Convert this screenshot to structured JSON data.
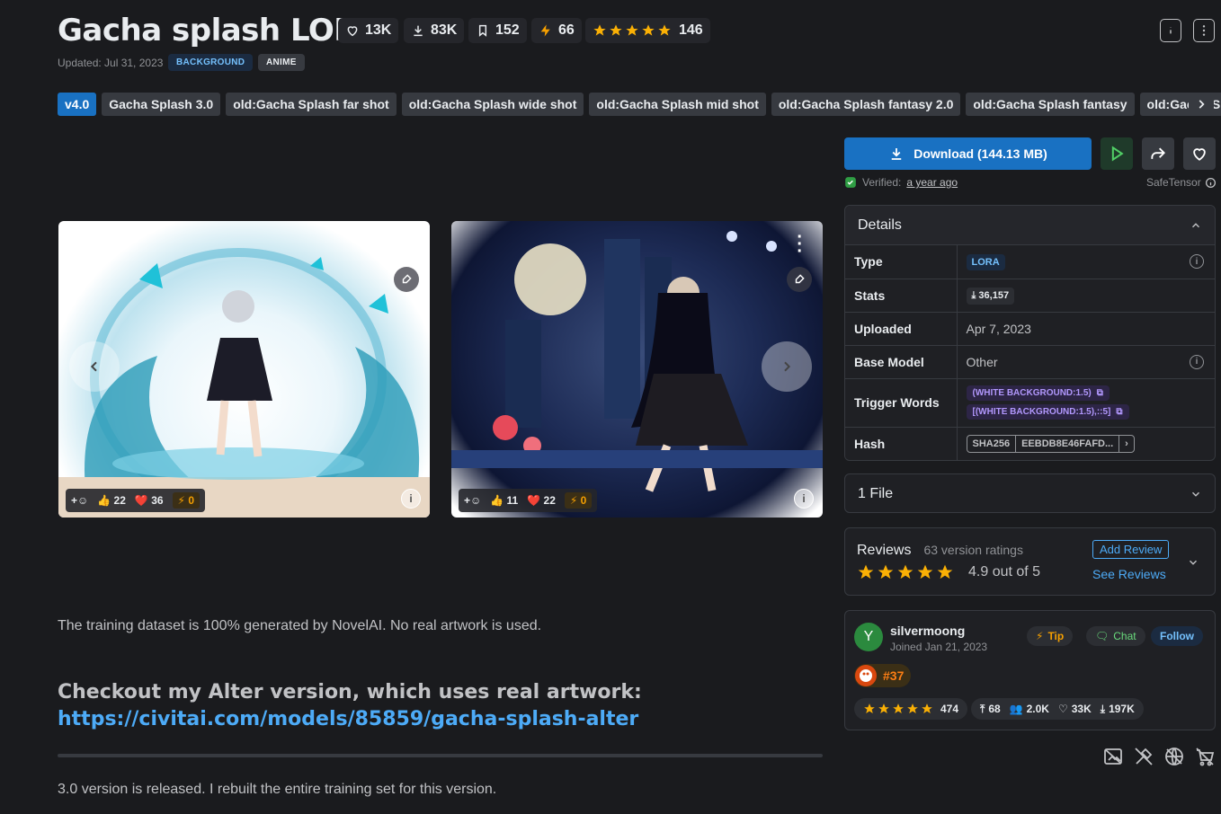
{
  "header": {
    "title": "Gacha splash LORA",
    "likes": "13K",
    "downloads": "83K",
    "bookmarks": "152",
    "buzz": "66",
    "rating_count": "146",
    "updated": "Updated: Jul 31, 2023",
    "tags": [
      "BACKGROUND",
      "ANIME"
    ]
  },
  "versions": [
    "v4.0",
    "Gacha Splash 3.0",
    "old:Gacha Splash far shot",
    "old:Gacha Splash wide shot",
    "old:Gacha Splash mid shot",
    "old:Gacha Splash fantasy 2.0",
    "old:Gacha Splash fantasy",
    "old:Gacha Splash"
  ],
  "gallery": [
    {
      "likes": "22",
      "hearts": "36",
      "buzz": "0"
    },
    {
      "likes": "11",
      "hearts": "22",
      "buzz": "0"
    }
  ],
  "description": {
    "p1": "The training dataset is 100% generated by NovelAI. No real artwork is used.",
    "heading": "Checkout my Alter version, which uses real artwork:",
    "link": "https://civitai.com/models/85859/gacha-splash-alter",
    "p2": "3.0 version is released. I rebuilt the entire training set for this version."
  },
  "download": {
    "label": "Download (144.13 MB)",
    "verified_prefix": "Verified:",
    "verified_when": "a year ago",
    "format": "SafeTensor"
  },
  "details": {
    "title": "Details",
    "rows": {
      "type_k": "Type",
      "type_v": "LORA",
      "stats_k": "Stats",
      "stats_v": "36,157",
      "uploaded_k": "Uploaded",
      "uploaded_v": "Apr 7, 2023",
      "base_k": "Base Model",
      "base_v": "Other",
      "trigger_k": "Trigger Words",
      "trigger_1": "(WHITE BACKGROUND:1.5)",
      "trigger_2": "[(WHITE BACKGROUND:1.5),::5]",
      "hash_k": "Hash",
      "hash_type": "SHA256",
      "hash_v": "EEBDB8E46FAFD..."
    }
  },
  "files": {
    "label": "1 File"
  },
  "reviews": {
    "title": "Reviews",
    "count": "63 version ratings",
    "score": "4.9 out of 5",
    "add": "Add Review",
    "see": "See Reviews"
  },
  "creator": {
    "avatar_letter": "Y",
    "name": "silvermoong",
    "joined": "Joined Jan 21, 2023",
    "tip": "Tip",
    "chat": "Chat",
    "follow": "Follow",
    "rank": "#37",
    "rating_count": "474",
    "uploads": "68",
    "followers": "2.0K",
    "likes": "33K",
    "downloads": "197K"
  },
  "colors": {
    "accent": "#1971c2",
    "star": "#fab005",
    "background": "#1a1b1e"
  },
  "icons": [
    "heart-icon",
    "download-icon",
    "bookmark-icon",
    "bolt-icon",
    "star-icon",
    "info-icon",
    "more-icon",
    "play-icon",
    "share-icon",
    "shield-check-icon",
    "chevron-up-icon",
    "chevron-down-icon",
    "copy-icon",
    "brush-icon"
  ]
}
